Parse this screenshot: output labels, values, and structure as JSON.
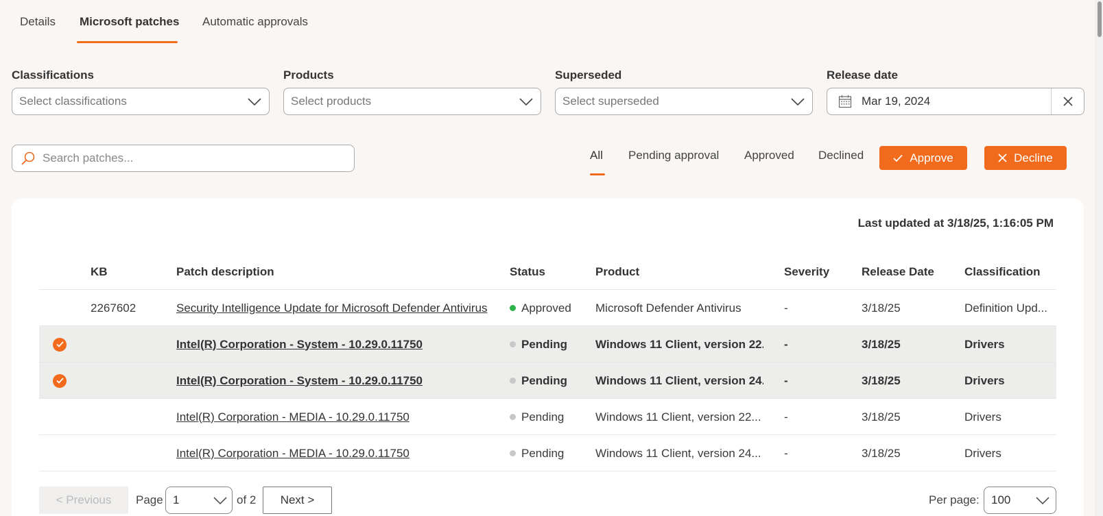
{
  "tabs": [
    {
      "label": "Details",
      "active": false
    },
    {
      "label": "Microsoft patches",
      "active": true
    },
    {
      "label": "Automatic approvals",
      "active": false
    }
  ],
  "filters": {
    "classifications": {
      "label": "Classifications",
      "placeholder": "Select classifications"
    },
    "products": {
      "label": "Products",
      "placeholder": "Select products"
    },
    "superseded": {
      "label": "Superseded",
      "placeholder": "Select superseded"
    },
    "release_date": {
      "label": "Release date",
      "value": "Mar 19, 2024"
    }
  },
  "search": {
    "placeholder": "Search patches..."
  },
  "status_tabs": [
    {
      "label": "All",
      "active": true
    },
    {
      "label": "Pending approval",
      "active": false
    },
    {
      "label": "Approved",
      "active": false
    },
    {
      "label": "Declined",
      "active": false
    }
  ],
  "actions": {
    "approve": "Approve",
    "decline": "Decline"
  },
  "last_updated": "Last updated at 3/18/25, 1:16:05 PM",
  "columns": [
    "KB",
    "Patch description",
    "Status",
    "Product",
    "Severity",
    "Release Date",
    "Classification"
  ],
  "rows": [
    {
      "selected": false,
      "kb": "2267602",
      "description": "Security Intelligence Update for Microsoft Defender Antivirus",
      "status": "Approved",
      "product": "Microsoft Defender Antivirus",
      "severity": "-",
      "release_date": "3/18/25",
      "classification": "Definition Upd..."
    },
    {
      "selected": true,
      "kb": "",
      "description": "Intel(R) Corporation - System - 10.29.0.11750",
      "status": "Pending",
      "product": "Windows 11 Client, version 22...",
      "severity": "-",
      "release_date": "3/18/25",
      "classification": "Drivers"
    },
    {
      "selected": true,
      "kb": "",
      "description": "Intel(R) Corporation - System - 10.29.0.11750",
      "status": "Pending",
      "product": "Windows 11 Client, version 24...",
      "severity": "-",
      "release_date": "3/18/25",
      "classification": "Drivers"
    },
    {
      "selected": false,
      "kb": "",
      "description": "Intel(R) Corporation - MEDIA - 10.29.0.11750",
      "status": "Pending",
      "product": "Windows 11 Client, version 22...",
      "severity": "-",
      "release_date": "3/18/25",
      "classification": "Drivers"
    },
    {
      "selected": false,
      "kb": "",
      "description": "Intel(R) Corporation - MEDIA - 10.29.0.11750",
      "status": "Pending",
      "product": "Windows 11 Client, version 24...",
      "severity": "-",
      "release_date": "3/18/25",
      "classification": "Drivers"
    }
  ],
  "status_colors": {
    "Approved": "#2bb24c",
    "Pending": "#c8c8c8"
  },
  "accent": "#f26b1d",
  "pagination": {
    "previous": "< Previous",
    "page_label": "Page",
    "page_value": "1",
    "of_label": "of 2",
    "next": "Next >",
    "per_page_label": "Per page:",
    "per_page_value": "100"
  },
  "icons": {
    "chevron": "chevron-down-icon",
    "calendar": "calendar-icon",
    "clear": "close-icon",
    "search": "search-icon",
    "check": "check-icon",
    "row_selected": "check-circle-icon"
  }
}
